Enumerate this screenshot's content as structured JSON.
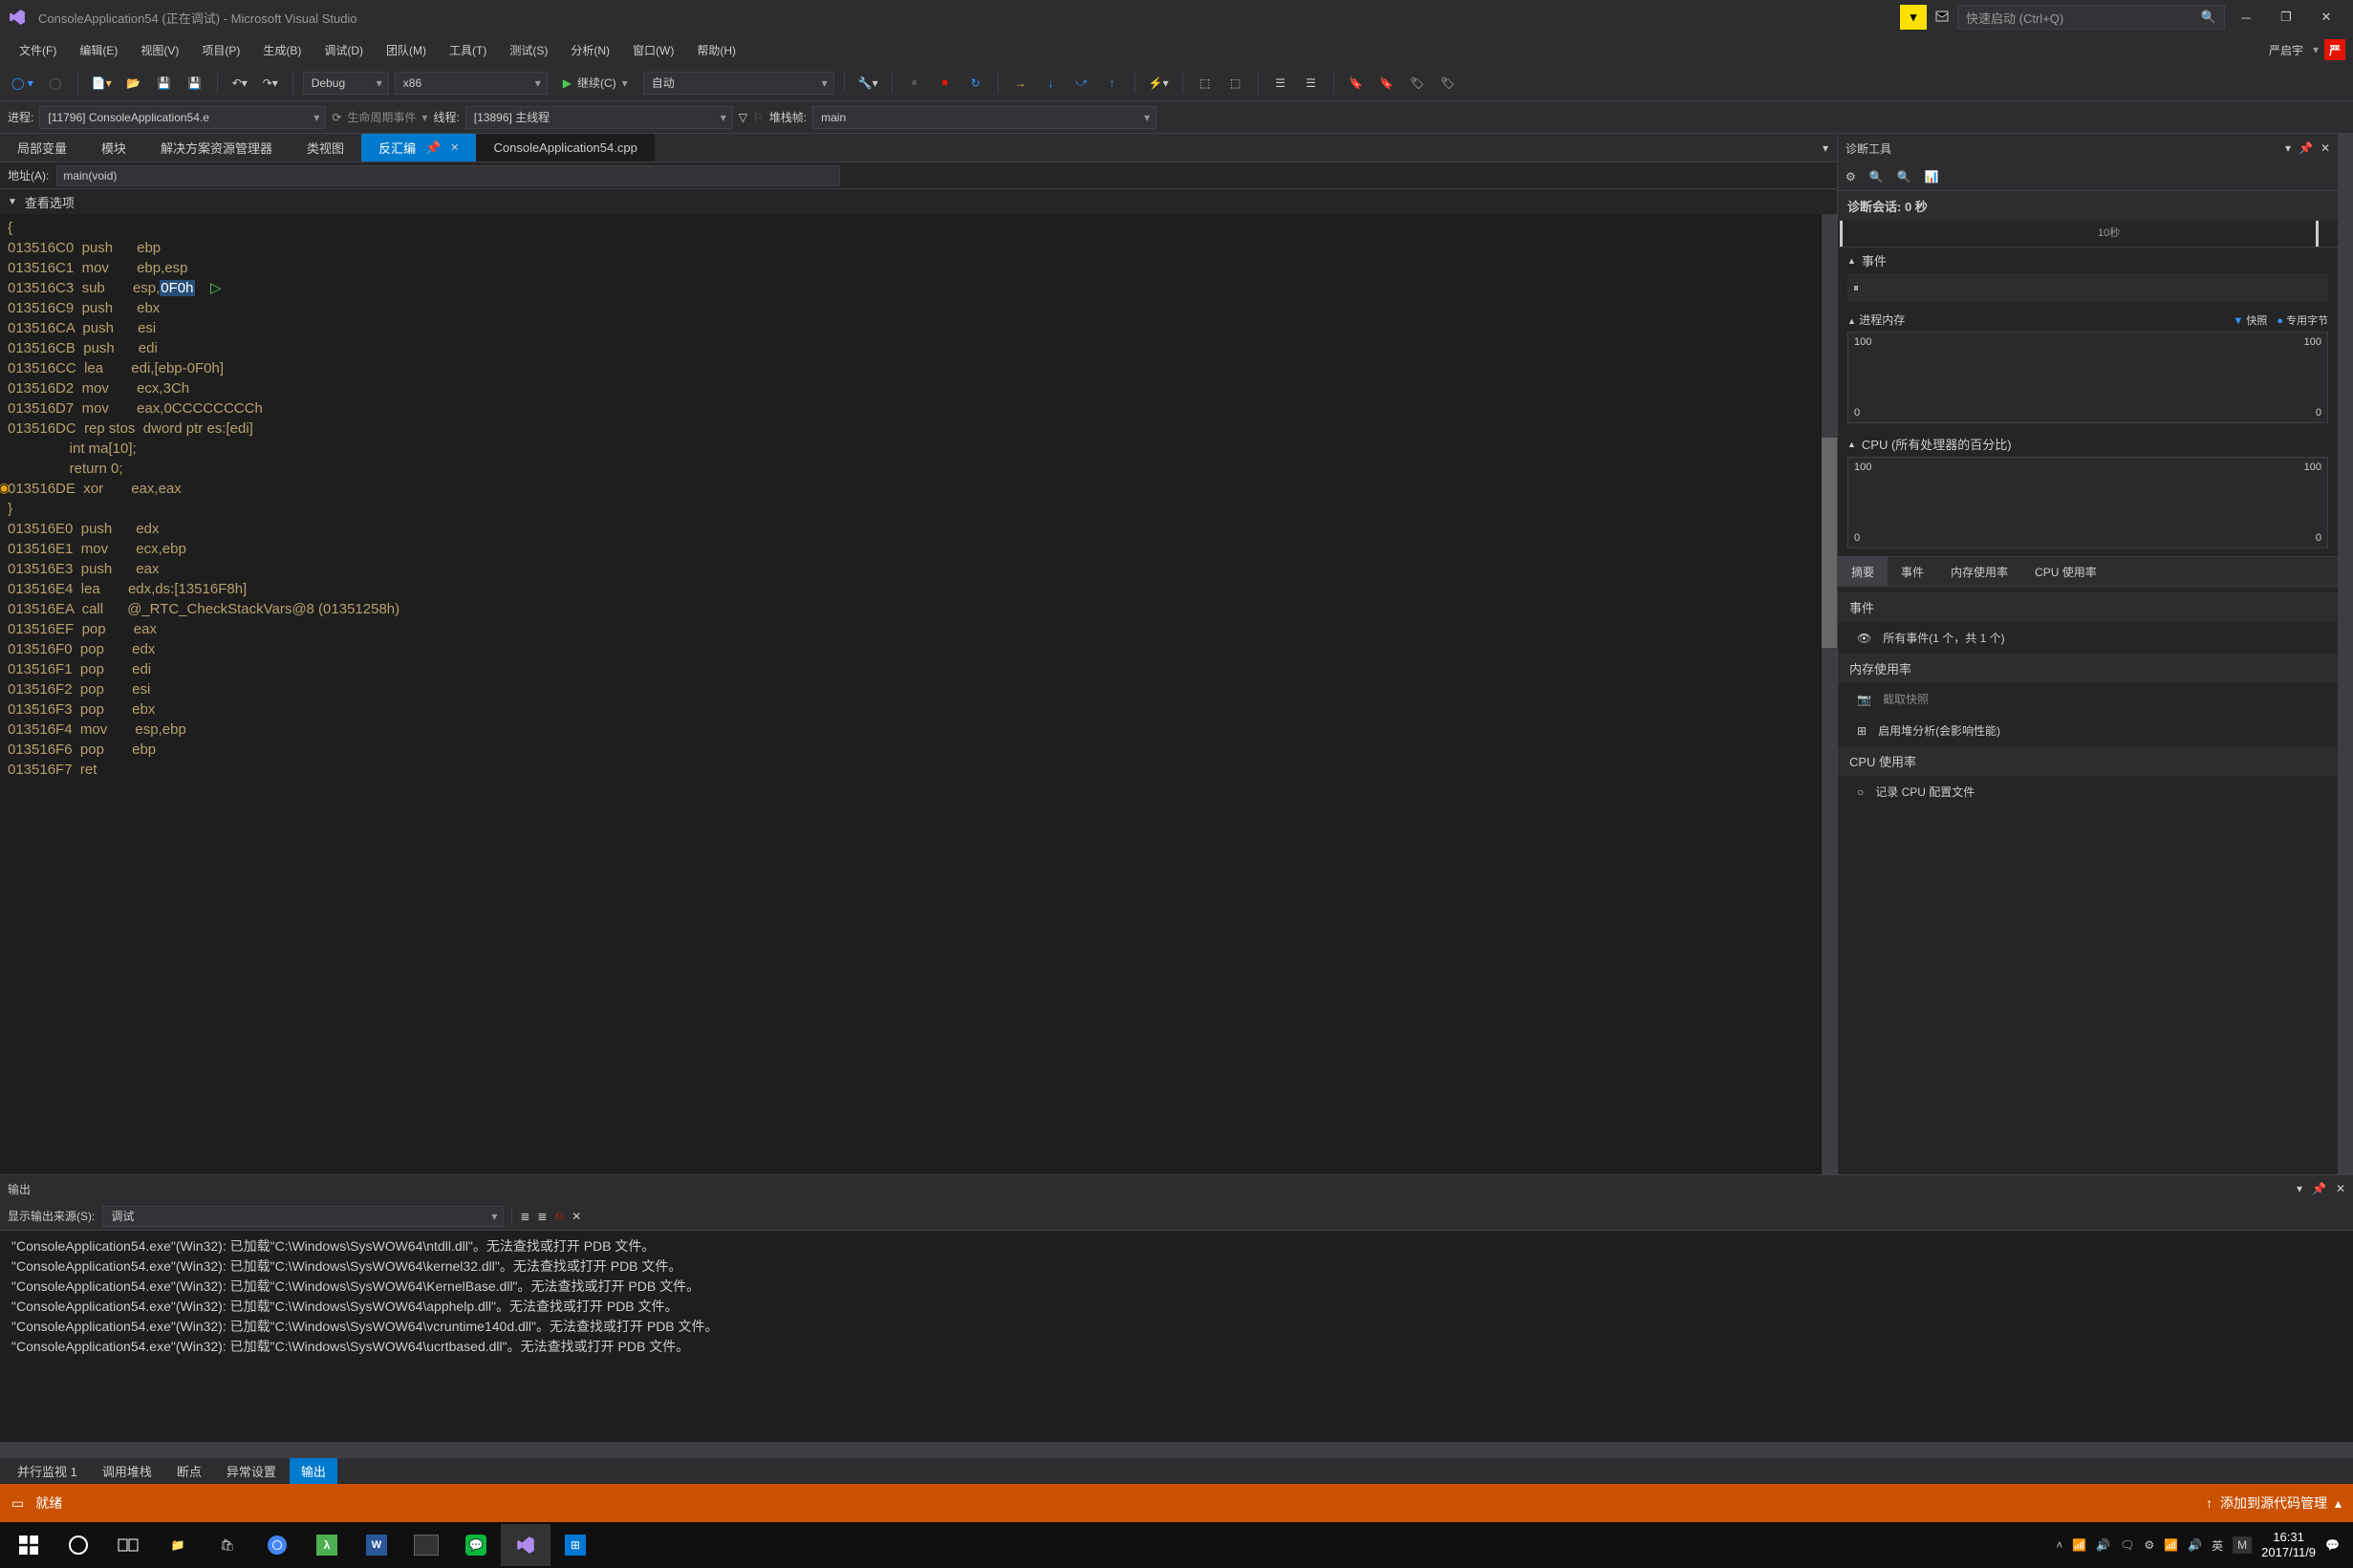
{
  "titlebar": {
    "title": "ConsoleApplication54 (正在调试) - Microsoft Visual Studio",
    "quick_launch_placeholder": "快速启动 (Ctrl+Q)"
  },
  "menubar": {
    "items": [
      "文件(F)",
      "编辑(E)",
      "视图(V)",
      "项目(P)",
      "生成(B)",
      "调试(D)",
      "团队(M)",
      "工具(T)",
      "测试(S)",
      "分析(N)",
      "窗口(W)",
      "帮助(H)"
    ],
    "user": "严启宇",
    "user_badge": "严"
  },
  "toolbar": {
    "config": "Debug",
    "platform": "x86",
    "continue": "继续(C)",
    "auto": "自动"
  },
  "toolbar2": {
    "process_label": "进程:",
    "process_value": "[11796] ConsoleApplication54.e",
    "lifecycle": "生命周期事件",
    "thread_label": "线程:",
    "thread_value": "[13896] 主线程",
    "stackframe_label": "堆栈帧:",
    "stackframe_value": "main"
  },
  "tabs": {
    "t0": "局部变量",
    "t1": "模块",
    "t2": "解决方案资源管理器",
    "t3": "类视图",
    "t4": "反汇编",
    "t5": "ConsoleApplication54.cpp"
  },
  "address": {
    "label": "地址(A):",
    "value": "main(void)"
  },
  "view_options": "查看选项",
  "disasm": [
    {
      "a": "",
      "raw": "{"
    },
    {
      "a": "013516C0",
      "op": "push",
      "arg": "ebp"
    },
    {
      "a": "013516C1",
      "op": "mov",
      "arg": "ebp,esp"
    },
    {
      "a": "013516C3",
      "op": "sub",
      "arg": "esp,",
      "sel": "0F0h",
      "marker": true
    },
    {
      "a": "013516C9",
      "op": "push",
      "arg": "ebx"
    },
    {
      "a": "013516CA",
      "op": "push",
      "arg": "esi"
    },
    {
      "a": "013516CB",
      "op": "push",
      "arg": "edi"
    },
    {
      "a": "013516CC",
      "op": "lea",
      "arg": "edi,[ebp-0F0h]"
    },
    {
      "a": "013516D2",
      "op": "mov",
      "arg": "ecx,3Ch"
    },
    {
      "a": "013516D7",
      "op": "mov",
      "arg": "eax,0CCCCCCCCh"
    },
    {
      "a": "013516DC",
      "op": "rep stos",
      "arg": "dword ptr es:[edi]"
    },
    {
      "src": "    int ma[10];"
    },
    {
      "src": "    return 0;"
    },
    {
      "a": "013516DE",
      "op": "xor",
      "arg": "eax,eax",
      "bp": true
    },
    {
      "a": "",
      "raw": "}"
    },
    {
      "a": "013516E0",
      "op": "push",
      "arg": "edx"
    },
    {
      "a": "013516E1",
      "op": "mov",
      "arg": "ecx,ebp"
    },
    {
      "a": "013516E3",
      "op": "push",
      "arg": "eax"
    },
    {
      "a": "013516E4",
      "op": "lea",
      "arg": "edx,ds:[13516F8h]"
    },
    {
      "a": "013516EA",
      "op": "call",
      "arg": "@_RTC_CheckStackVars@8 (01351258h)"
    },
    {
      "a": "013516EF",
      "op": "pop",
      "arg": "eax"
    },
    {
      "a": "013516F0",
      "op": "pop",
      "arg": "edx"
    },
    {
      "a": "013516F1",
      "op": "pop",
      "arg": "edi"
    },
    {
      "a": "013516F2",
      "op": "pop",
      "arg": "esi"
    },
    {
      "a": "013516F3",
      "op": "pop",
      "arg": "ebx"
    },
    {
      "a": "013516F4",
      "op": "mov",
      "arg": "esp,ebp"
    },
    {
      "a": "013516F6",
      "op": "pop",
      "arg": "ebp"
    },
    {
      "a": "013516F7",
      "op": "ret",
      "arg": ""
    }
  ],
  "diag": {
    "title": "诊断工具",
    "session": "诊断会话: 0 秒",
    "timeline_tick": "10秒",
    "events": "事件",
    "mem_header": "进程内存",
    "snapshot": "快照",
    "private_bytes": "专用字节",
    "cpu_header": "CPU (所有处理器的百分比)",
    "y100": "100",
    "y0": "0",
    "sub_tabs": [
      "摘要",
      "事件",
      "内存使用率",
      "CPU 使用率"
    ],
    "sec_events": "事件",
    "all_events": "所有事件(1 个，共 1 个)",
    "sec_mem": "内存使用率",
    "snapshot_btn": "截取快照",
    "heap_btn": "启用堆分析(会影响性能)",
    "sec_cpu": "CPU 使用率",
    "record_cpu": "记录 CPU 配置文件"
  },
  "output": {
    "title": "输出",
    "source_label": "显示输出来源(S):",
    "source_value": "调试",
    "lines": [
      "\"ConsoleApplication54.exe\"(Win32): 已加载\"C:\\Windows\\SysWOW64\\ntdll.dll\"。无法查找或打开 PDB 文件。",
      "\"ConsoleApplication54.exe\"(Win32): 已加载\"C:\\Windows\\SysWOW64\\kernel32.dll\"。无法查找或打开 PDB 文件。",
      "\"ConsoleApplication54.exe\"(Win32): 已加载\"C:\\Windows\\SysWOW64\\KernelBase.dll\"。无法查找或打开 PDB 文件。",
      "\"ConsoleApplication54.exe\"(Win32): 已加载\"C:\\Windows\\SysWOW64\\apphelp.dll\"。无法查找或打开 PDB 文件。",
      "\"ConsoleApplication54.exe\"(Win32): 已加载\"C:\\Windows\\SysWOW64\\vcruntime140d.dll\"。无法查找或打开 PDB 文件。",
      "\"ConsoleApplication54.exe\"(Win32): 已加载\"C:\\Windows\\SysWOW64\\ucrtbased.dll\"。无法查找或打开 PDB 文件。"
    ]
  },
  "bottom_tabs": [
    "并行监视 1",
    "调用堆栈",
    "断点",
    "异常设置",
    "输出"
  ],
  "statusbar": {
    "ready": "就绪",
    "add_source": "添加到源代码管理"
  },
  "taskbar": {
    "time": "16:31",
    "date": "2017/11/9",
    "ime": "英",
    "ime2": "M"
  }
}
